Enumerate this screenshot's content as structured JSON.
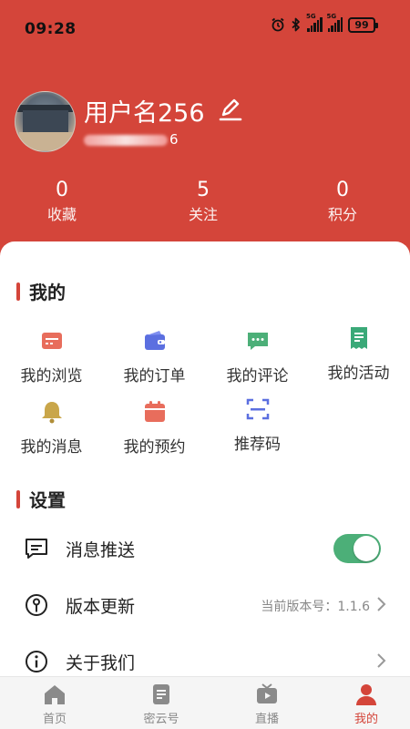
{
  "status_bar": {
    "time": "09:28",
    "battery": "99",
    "net1": "5G",
    "net2": "5G"
  },
  "profile": {
    "username": "用户名256",
    "phone_suffix": "6"
  },
  "stats": [
    {
      "value": "0",
      "label": "收藏"
    },
    {
      "value": "5",
      "label": "关注"
    },
    {
      "value": "0",
      "label": "积分"
    }
  ],
  "mine": {
    "title": "我的",
    "items": [
      {
        "label": "我的浏览",
        "icon": "browse-history-icon",
        "color": "#e86d5c"
      },
      {
        "label": "我的订单",
        "icon": "wallet-icon",
        "color": "#5b6fe0"
      },
      {
        "label": "我的评论",
        "icon": "comment-icon",
        "color": "#4caf78"
      },
      {
        "label": "我的活动",
        "icon": "receipt-icon",
        "color": "#3aa978"
      },
      {
        "label": "我的消息",
        "icon": "bell-icon",
        "color": "#c9a64a"
      },
      {
        "label": "我的预约",
        "icon": "calendar-icon",
        "color": "#e86d5c"
      },
      {
        "label": "推荐码",
        "icon": "scan-icon",
        "color": "#5b6fe0"
      }
    ]
  },
  "settings": {
    "title": "设置",
    "push": {
      "label": "消息推送",
      "enabled": true
    },
    "version": {
      "label": "版本更新",
      "value": "当前版本号：1.1.6"
    },
    "about": {
      "label": "关于我们"
    }
  },
  "tabbar": [
    {
      "label": "首页",
      "icon": "home-icon",
      "active": false
    },
    {
      "label": "密云号",
      "icon": "document-icon",
      "active": false
    },
    {
      "label": "直播",
      "icon": "tv-icon",
      "active": false
    },
    {
      "label": "我的",
      "icon": "person-icon",
      "active": true
    }
  ],
  "colors": {
    "primary": "#d4453a",
    "toggle_on": "#4caf78"
  }
}
